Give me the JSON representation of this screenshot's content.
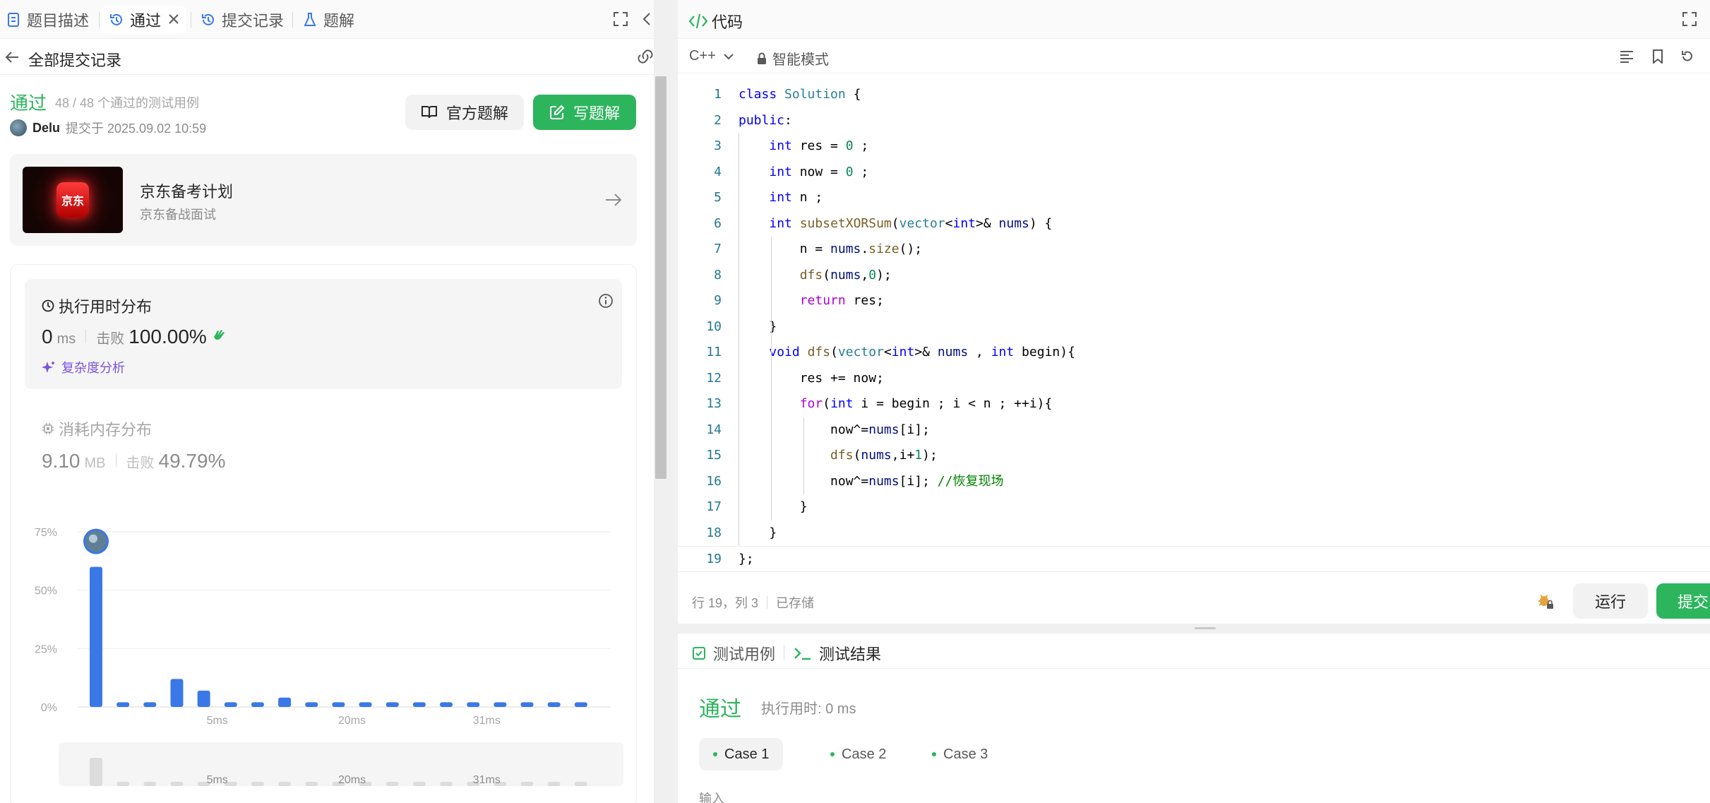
{
  "left_tabs": {
    "description": "题目描述",
    "passed": "通过",
    "submissions": "提交记录",
    "solutions": "题解"
  },
  "subheader": {
    "back_label": "全部提交记录"
  },
  "result": {
    "status": "通过",
    "count": "48 / 48 个通过的测试用例",
    "user": "Delu",
    "submitted_at": "提交于 2025.09.02 10:59"
  },
  "buttons": {
    "official_solution": "官方题解",
    "write_solution": "写题解"
  },
  "promo": {
    "logo_text": "京东",
    "title": "京东备考计划",
    "subtitle": "京东备战面试"
  },
  "runtime": {
    "title": "执行用时分布",
    "value": "0",
    "unit": "ms",
    "beat_label": "击败",
    "beat_value": "100.00%",
    "complexity_label": "复杂度分析"
  },
  "memory": {
    "title": "消耗内存分布",
    "value": "9.10",
    "unit": "MB",
    "beat_label": "击败",
    "beat_value": "49.79%"
  },
  "chart_data": {
    "type": "bar",
    "y_ticks": [
      "75%",
      "50%",
      "25%",
      "0%"
    ],
    "ylim": [
      0,
      75
    ],
    "x_tick_labels": [
      "5ms",
      "20ms",
      "31ms"
    ],
    "values": [
      60,
      2,
      2,
      12,
      7,
      2,
      2,
      4,
      2,
      2,
      2,
      2,
      2,
      2,
      2,
      2,
      2,
      2,
      2
    ],
    "highlight_index": 0,
    "bar_color": "#3a78e8",
    "overview_x_tick_labels": [
      "5ms",
      "20ms",
      "31ms"
    ]
  },
  "editor": {
    "title": "代码",
    "language": "C++",
    "mode": "智能模式",
    "status_position": "行 19，列 3",
    "status_saved": "已存储",
    "run_label": "运行",
    "submit_label": "提交"
  },
  "code": [
    {
      "n": "1",
      "t": "class Solution {"
    },
    {
      "n": "2",
      "t": "public:"
    },
    {
      "n": "3",
      "t": "    int res = 0 ;"
    },
    {
      "n": "4",
      "t": "    int now = 0 ;"
    },
    {
      "n": "5",
      "t": "    int n ;"
    },
    {
      "n": "6",
      "t": "    int subsetXORSum(vector<int>& nums) {"
    },
    {
      "n": "7",
      "t": "        n = nums.size();"
    },
    {
      "n": "8",
      "t": "        dfs(nums,0);"
    },
    {
      "n": "9",
      "t": "        return res;"
    },
    {
      "n": "10",
      "t": "    }"
    },
    {
      "n": "11",
      "t": "    void dfs(vector<int>& nums , int begin){"
    },
    {
      "n": "12",
      "t": "        res += now;"
    },
    {
      "n": "13",
      "t": "        for(int i = begin ; i < n ; ++i){"
    },
    {
      "n": "14",
      "t": "            now^=nums[i];"
    },
    {
      "n": "15",
      "t": "            dfs(nums,i+1);"
    },
    {
      "n": "16",
      "t": "            now^=nums[i]; //恢复现场"
    },
    {
      "n": "17",
      "t": "        }"
    },
    {
      "n": "18",
      "t": "    }"
    },
    {
      "n": "19",
      "t": "};"
    }
  ],
  "results": {
    "tab_testcase": "测试用例",
    "tab_result": "测试结果",
    "status": "通过",
    "runtime": "执行用时: 0 ms",
    "cases": [
      "Case 1",
      "Case 2",
      "Case 3"
    ],
    "input_label": "输入"
  },
  "colors": {
    "accent_green": "#2db55d",
    "bar_blue": "#3a78e8",
    "purple": "#7a55d9"
  }
}
